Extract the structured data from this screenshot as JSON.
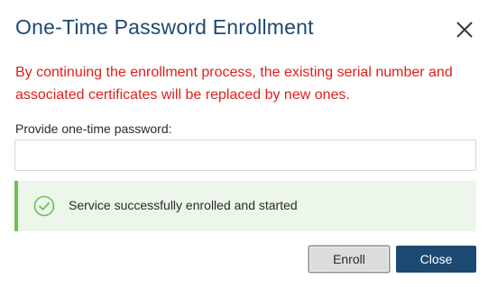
{
  "dialog": {
    "title": "One-Time Password Enrollment",
    "close_icon": "close-icon",
    "warning": "By continuing the enrollment process, the existing serial number and associated certificates will be replaced by new ones.",
    "otp_label": "Provide one-time password:",
    "otp_value": "",
    "otp_placeholder": ""
  },
  "alert": {
    "icon": "check-circle-icon",
    "message": "Service successfully enrolled and started",
    "status": "success"
  },
  "buttons": {
    "enroll_label": "Enroll",
    "close_label": "Close"
  },
  "colors": {
    "title": "#1d4a72",
    "warning": "#e0201a",
    "success_border": "#6fbf5a",
    "success_bg": "#ecf6ea",
    "primary_button": "#1d4a72"
  }
}
